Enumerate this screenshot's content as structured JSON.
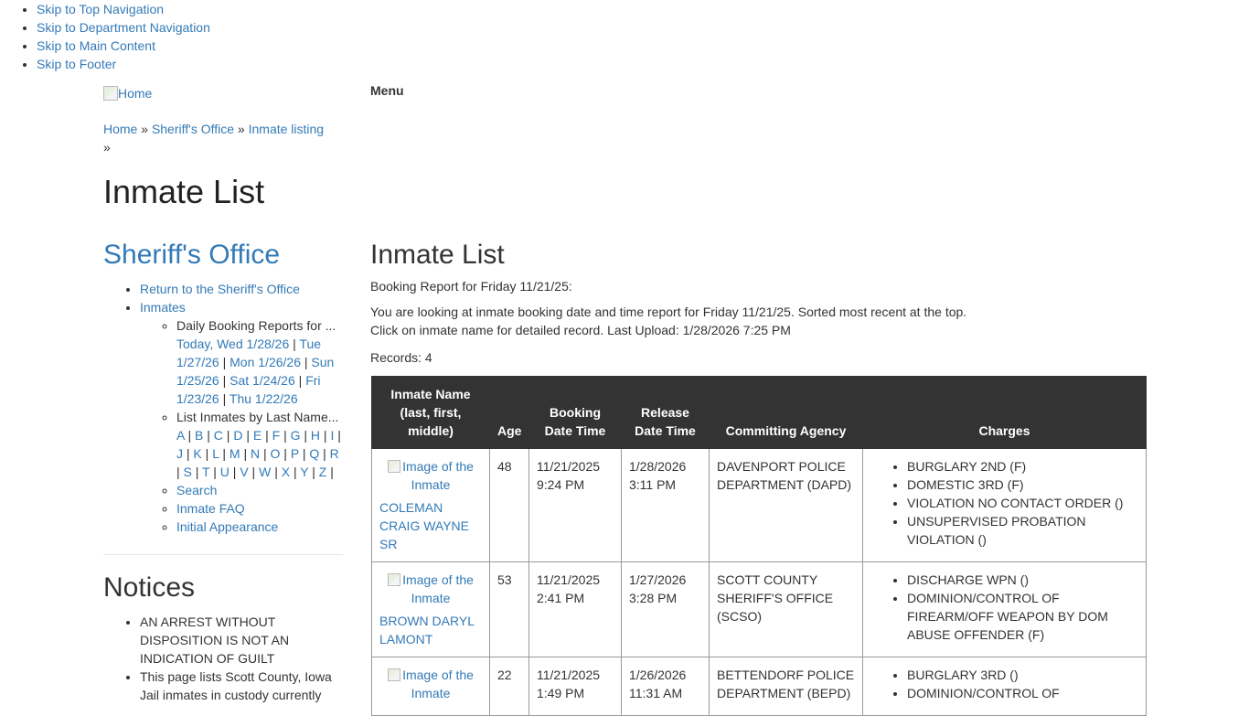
{
  "skip_links": [
    "Skip to Top Navigation",
    "Skip to Department Navigation",
    "Skip to Main Content",
    "Skip to Footer"
  ],
  "header": {
    "logo_alt": "Home",
    "menu_label": "Menu"
  },
  "breadcrumb": {
    "items": [
      "Home",
      "Sheriff's Office",
      "Inmate listing"
    ],
    "separator": "»"
  },
  "page_title": "Inmate List",
  "sidebar": {
    "title": "Sheriff's Office",
    "return_link": "Return to the Sheriff's Office",
    "inmates_link": "Inmates",
    "daily_booking_label": "Daily Booking Reports for ...",
    "daily_links": [
      "Today, Wed 1/28/26",
      "Tue 1/27/26",
      "Mon 1/26/26",
      "Sun 1/25/26",
      "Sat 1/24/26",
      "Fri 1/23/26",
      "Thu 1/22/26"
    ],
    "list_by_name_label": "List Inmates by Last Name...",
    "letters": [
      "A",
      "B",
      "C",
      "D",
      "E",
      "F",
      "G",
      "H",
      "I",
      "J",
      "K",
      "L",
      "M",
      "N",
      "O",
      "P",
      "Q",
      "R",
      "S",
      "T",
      "U",
      "V",
      "W",
      "X",
      "Y",
      "Z"
    ],
    "search_link": "Search",
    "faq_link": "Inmate FAQ",
    "initial_link": "Initial Appearance"
  },
  "notices": {
    "title": "Notices",
    "items": [
      "AN ARREST WITHOUT DISPOSITION IS NOT AN INDICATION OF GUILT",
      "This page lists Scott County, Iowa Jail inmates in custody currently"
    ]
  },
  "main": {
    "title": "Inmate List",
    "booking_report": "Booking Report for Friday 11/21/25:",
    "description_line1": "You are looking at inmate booking date and time report for Friday 11/21/25. Sorted most recent at the top.",
    "description_line2": "Click on inmate name for detailed record. Last Upload: 1/28/2026 7:25 PM",
    "records": "Records: 4"
  },
  "table": {
    "headers": {
      "name": "Inmate Name (last, first, middle)",
      "age": "Age",
      "booking": "Booking Date Time",
      "release": "Release Date Time",
      "agency": "Committing Agency",
      "charges": "Charges"
    },
    "image_alt": "Image of the Inmate",
    "rows": [
      {
        "name": "COLEMAN CRAIG WAYNE SR",
        "age": "48",
        "booking_date": "11/21/2025",
        "booking_time": "9:24 PM",
        "release_date": "1/28/2026",
        "release_time": "3:11 PM",
        "agency": "DAVENPORT POLICE DEPARTMENT (DAPD)",
        "charges": [
          "BURGLARY 2ND (F)",
          "DOMESTIC 3RD (F)",
          "VIOLATION NO CONTACT ORDER ()",
          "UNSUPERVISED PROBATION VIOLATION ()"
        ]
      },
      {
        "name": "BROWN DARYL LAMONT",
        "age": "53",
        "booking_date": "11/21/2025",
        "booking_time": "2:41 PM",
        "release_date": "1/27/2026",
        "release_time": "3:28 PM",
        "agency": "SCOTT COUNTY SHERIFF'S OFFICE (SCSO)",
        "charges": [
          "DISCHARGE WPN ()",
          "DOMINION/CONTROL OF FIREARM/OFF WEAPON BY DOM ABUSE OFFENDER (F)"
        ]
      },
      {
        "name": "",
        "age": "22",
        "booking_date": "11/21/2025",
        "booking_time": "1:49 PM",
        "release_date": "1/26/2026",
        "release_time": "11:31 AM",
        "agency": "BETTENDORF POLICE DEPARTMENT (BEPD)",
        "charges": [
          "BURGLARY 3RD ()",
          "DOMINION/CONTROL OF"
        ]
      }
    ]
  }
}
